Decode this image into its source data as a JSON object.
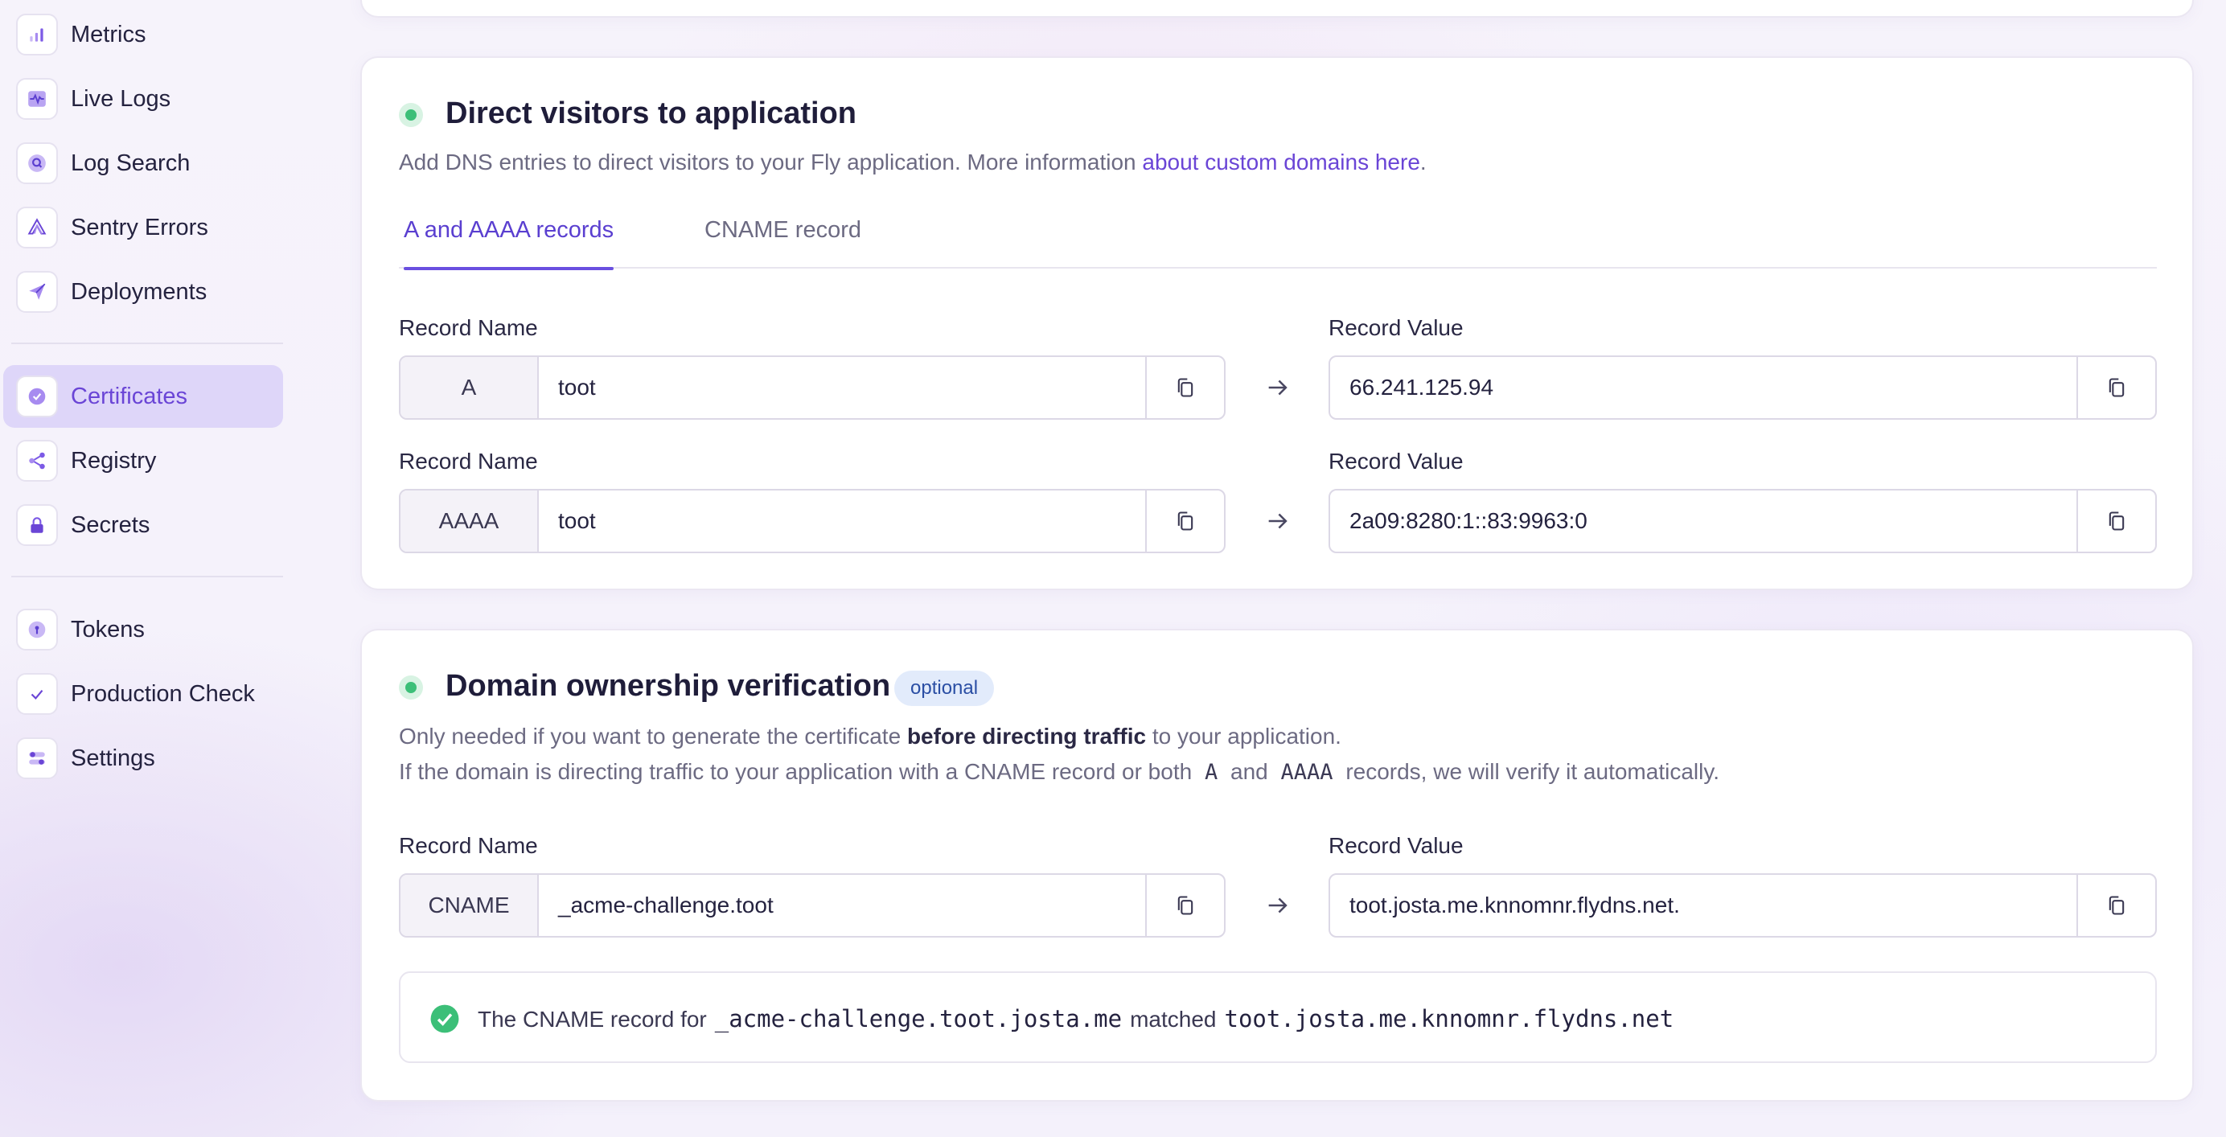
{
  "sidebar": {
    "items": [
      {
        "label": "Metrics",
        "icon": "bar-chart-icon"
      },
      {
        "label": "Live Logs",
        "icon": "pulse-icon"
      },
      {
        "label": "Log Search",
        "icon": "search-icon"
      },
      {
        "label": "Sentry Errors",
        "icon": "sentry-icon"
      },
      {
        "label": "Deployments",
        "icon": "paper-plane-icon"
      },
      {
        "label": "Certificates",
        "icon": "badge-check-icon",
        "active": true
      },
      {
        "label": "Registry",
        "icon": "share-nodes-icon"
      },
      {
        "label": "Secrets",
        "icon": "lock-icon"
      },
      {
        "label": "Tokens",
        "icon": "token-icon"
      },
      {
        "label": "Production Check",
        "icon": "check-icon"
      },
      {
        "label": "Settings",
        "icon": "toggles-icon"
      }
    ]
  },
  "direct": {
    "title": "Direct visitors to application",
    "desc_prefix": "Add DNS entries to direct visitors to your Fly application. More information ",
    "desc_link": "about custom domains here",
    "desc_suffix": ".",
    "tabs": [
      {
        "label": "A and AAAA records",
        "active": true
      },
      {
        "label": "CNAME record",
        "active": false
      }
    ],
    "records": [
      {
        "name_label": "Record Name",
        "type": "A",
        "name": "toot",
        "value_label": "Record Value",
        "value": "66.241.125.94"
      },
      {
        "name_label": "Record Name",
        "type": "AAAA",
        "name": "toot",
        "value_label": "Record Value",
        "value": "2a09:8280:1::83:9963:0"
      }
    ]
  },
  "ownership": {
    "title": "Domain ownership verification",
    "badge": "optional",
    "desc1_prefix": "Only needed if you want to generate the certificate ",
    "desc1_bold": "before directing traffic",
    "desc1_suffix": " to your application.",
    "desc2_prefix": "If the domain is directing traffic to your application with a CNAME record or both",
    "desc2_code1": "A",
    "desc2_mid": "and",
    "desc2_code2": "AAAA",
    "desc2_suffix": "records, we will verify it automatically.",
    "record": {
      "name_label": "Record Name",
      "type": "CNAME",
      "name": "_acme-challenge.toot",
      "value_label": "Record Value",
      "value": "toot.josta.me.knnomnr.flydns.net."
    },
    "match": {
      "prefix": "The CNAME record for",
      "source": "_acme-challenge.toot.josta.me",
      "mid": "matched",
      "target": "toot.josta.me.knnomnr.flydns.net"
    }
  },
  "colors": {
    "accent": "#6a45d6",
    "success": "#3cbf78",
    "badge_bg": "#e2ebfb"
  }
}
